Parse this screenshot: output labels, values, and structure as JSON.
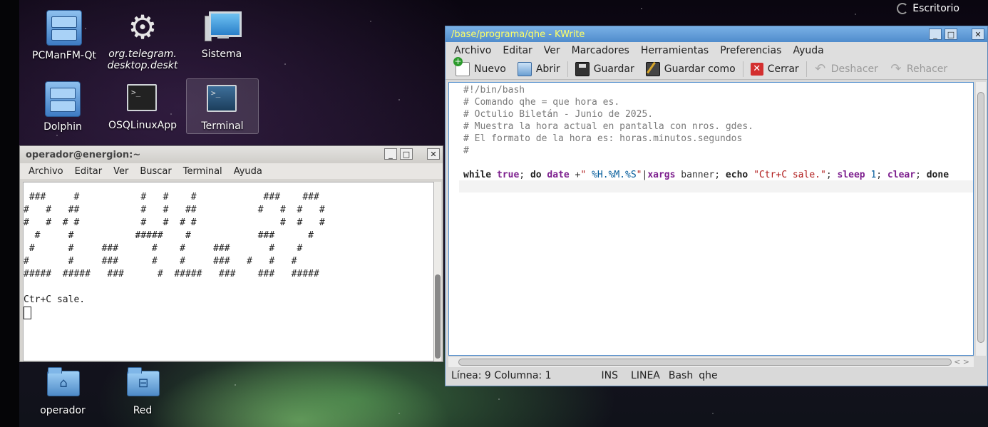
{
  "desktop": {
    "indicator_label": "Escritorio",
    "icons": [
      {
        "label": "PCManFM-Qt",
        "icon": "file-cabinet-icon"
      },
      {
        "label": "org.telegram.desktop.deskt",
        "icon": "gear-icon"
      },
      {
        "label": "Sistema",
        "icon": "computer-icon"
      },
      {
        "label": "Dolphin",
        "icon": "file-cabinet-icon"
      },
      {
        "label": "OSQLinuxApp",
        "icon": "terminal-icon"
      },
      {
        "label": "Terminal",
        "icon": "terminal-icon"
      },
      {
        "label": "operador",
        "icon": "home-folder-icon"
      },
      {
        "label": "Red",
        "icon": "network-folder-icon"
      }
    ]
  },
  "terminal": {
    "title": "operador@energion:~",
    "menu": [
      "Archivo",
      "Editar",
      "Ver",
      "Buscar",
      "Terminal",
      "Ayuda"
    ],
    "output": " ###     #           #   #    #            ###    ###\n#   #   ##           #   #   ##           #   #  #   #\n#   #  # #           #   #  # #               #  #   #\n  #     #           #####    #            ###      #\n #      #     ###      #    #     ###       #    #\n#       #     ###      #    #     ###   #   #   #\n#####  #####   ###      #  #####   ###    ###   #####\n\nCtr+C sale.\n",
    "buttons": {
      "minimize": "_",
      "maximize": "□",
      "close": "✕"
    }
  },
  "kwrite": {
    "title": "/base/programa/qhe - KWrite",
    "menu": [
      "Archivo",
      "Editar",
      "Ver",
      "Marcadores",
      "Herramientas",
      "Preferencias",
      "Ayuda"
    ],
    "toolbar": {
      "nuevo": "Nuevo",
      "abrir": "Abrir",
      "guardar": "Guardar",
      "guardar_como": "Guardar como",
      "cerrar": "Cerrar",
      "deshacer": "Deshacer",
      "rehacer": "Rehacer"
    },
    "code_lines": [
      "#!/bin/bash",
      "# Comando qhe = que hora es.",
      "# Octulio Biletán - Junio de 2025.",
      "# Muestra la hora actual en pantalla con nros. gdes.",
      "# El formato de la hora es: horas.minutos.segundos",
      "#"
    ],
    "status": {
      "position": "Línea: 9 Columna: 1",
      "mode": "INS",
      "linea": "LINEA",
      "syntax": "Bash",
      "filename": "qhe"
    },
    "buttons": {
      "minimize": "_",
      "maximize": "□",
      "close": "✕"
    }
  }
}
